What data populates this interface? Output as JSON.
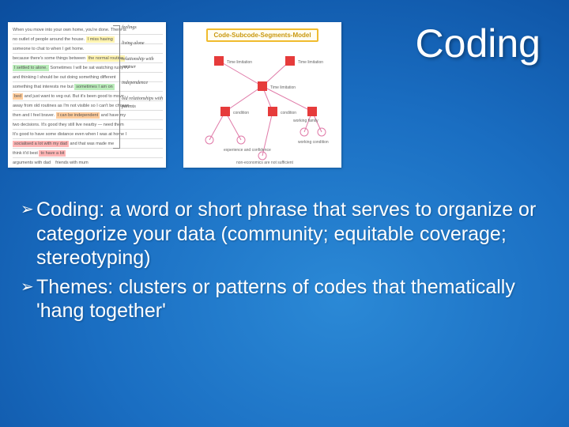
{
  "title": "Coding",
  "figures": {
    "model_label": "Code-Subcode-Segments-Model",
    "notes": {
      "n1": "feelings",
      "n2": "living alone",
      "n3": "relationship with partner",
      "n4": "independence",
      "n5": "old relationships with parents"
    }
  },
  "bullets": [
    {
      "lead": "Coding:",
      "rest": " a word or short phrase that serves to organize or categorize your data (community; equitable coverage; stereotyping)"
    },
    {
      "lead": "Themes:",
      "rest": " clusters or patterns of codes that thematically 'hang together'"
    }
  ]
}
